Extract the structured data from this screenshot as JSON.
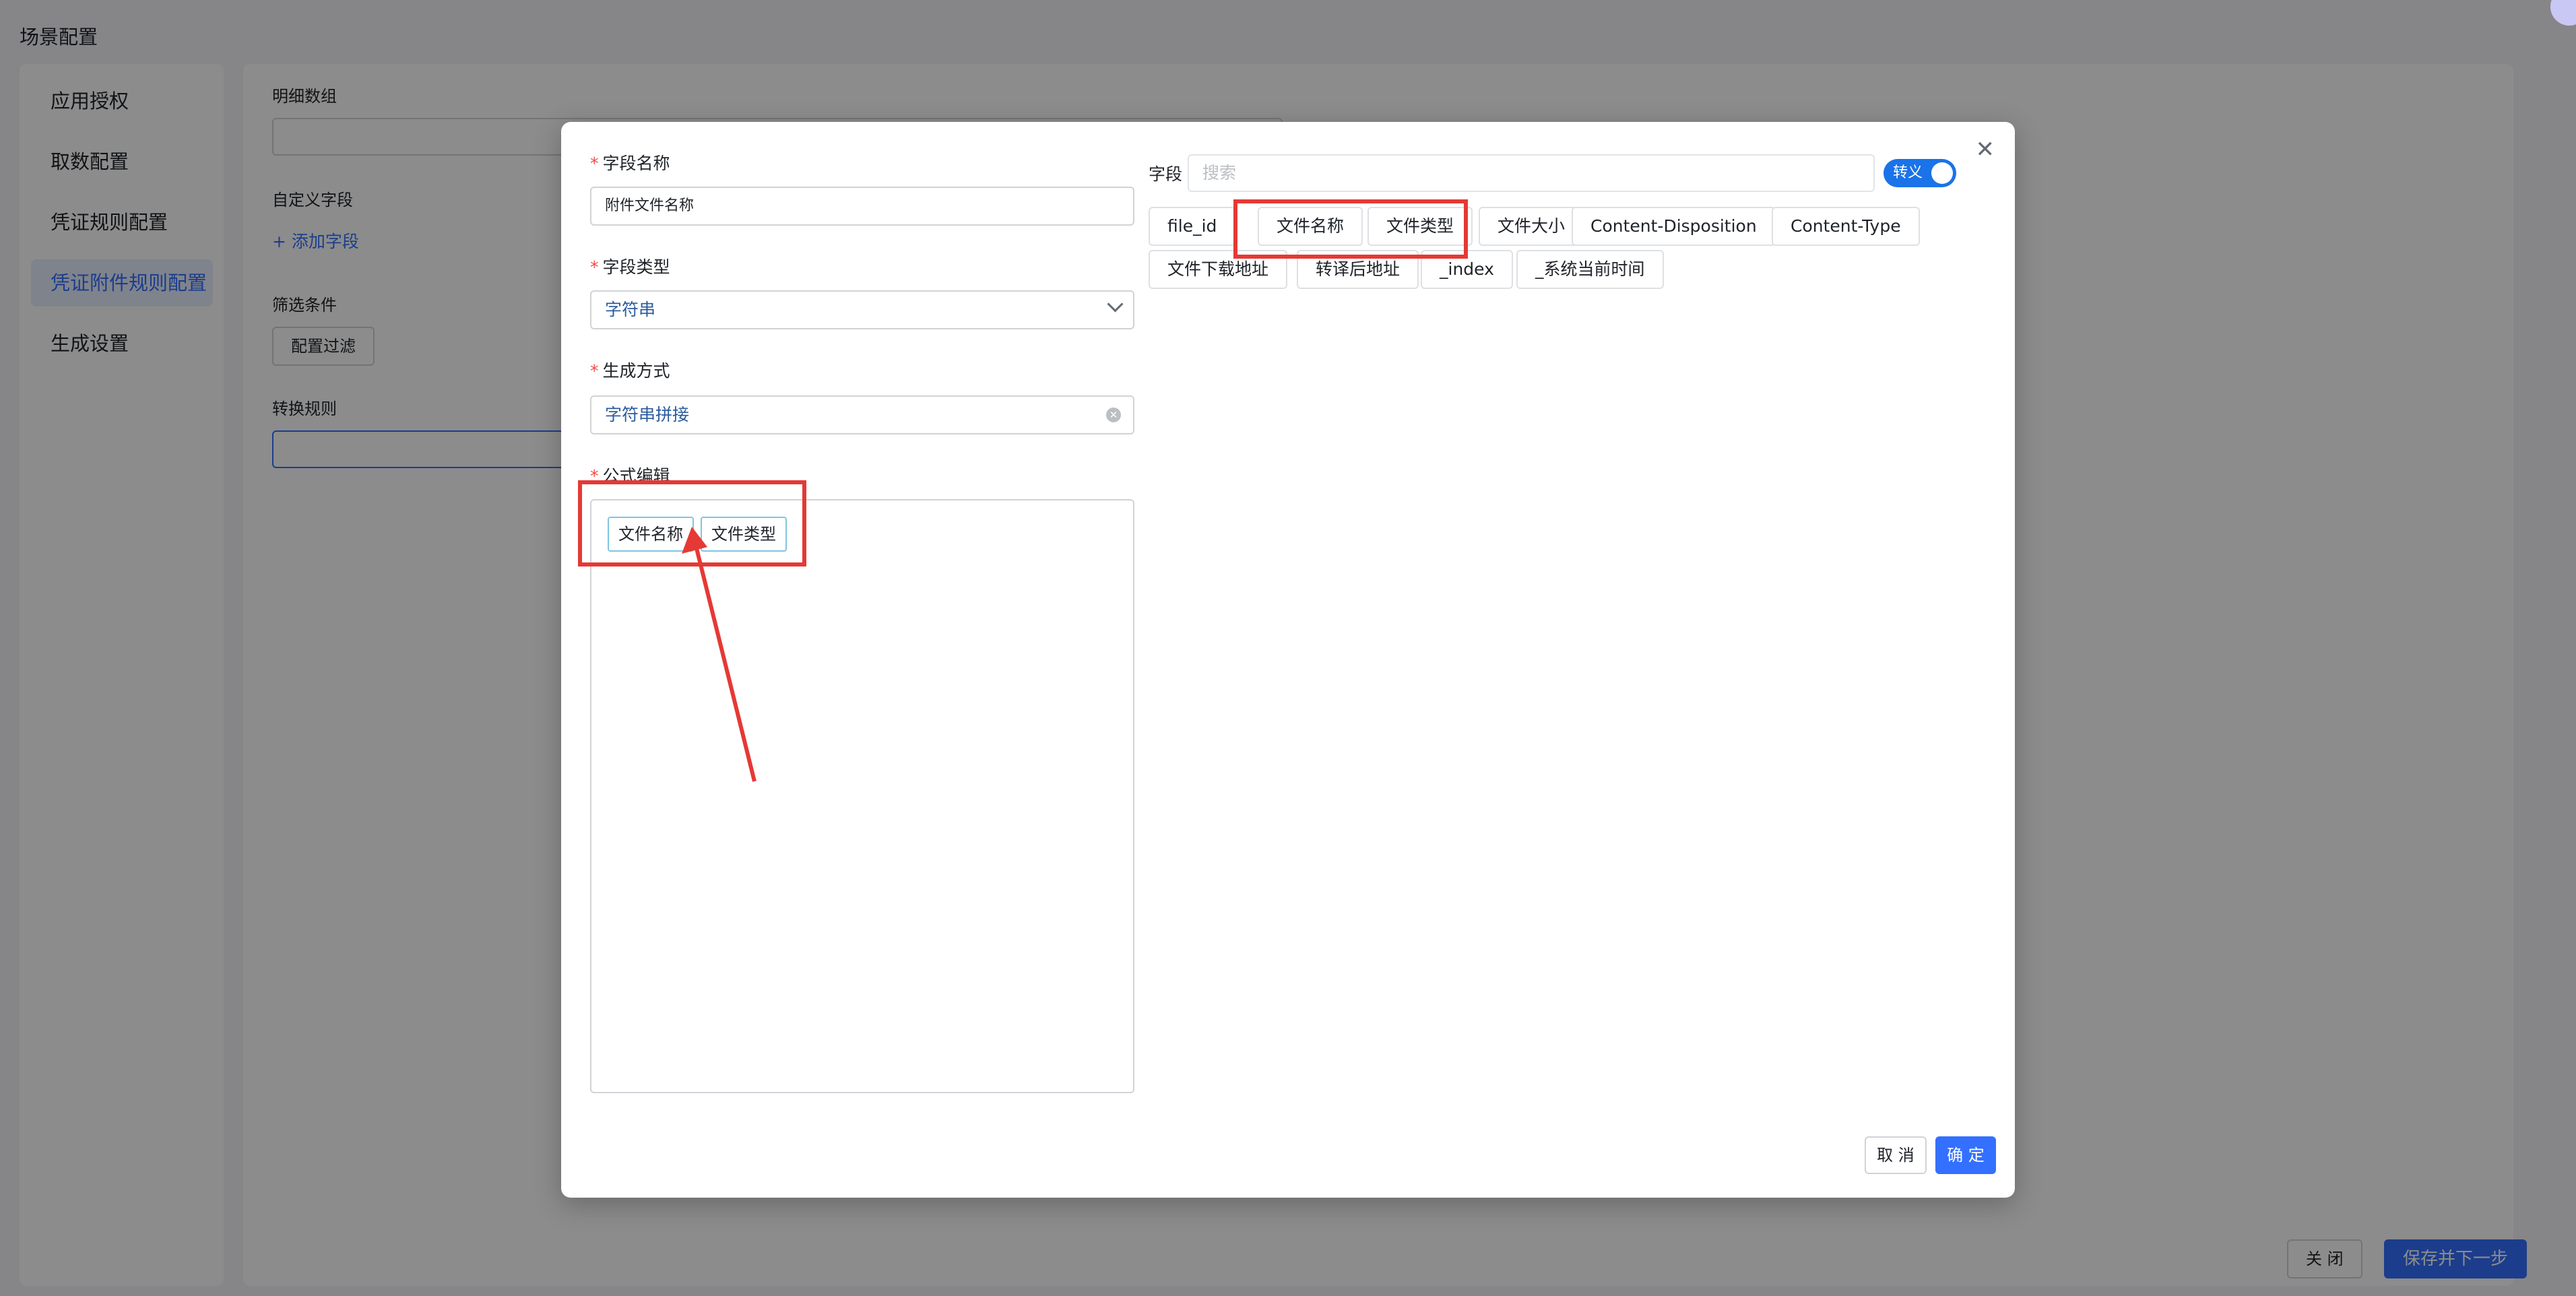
{
  "page": {
    "title": "场景配置"
  },
  "left_nav": {
    "items": [
      {
        "label": "应用授权",
        "active": false
      },
      {
        "label": "取数配置",
        "active": false
      },
      {
        "label": "凭证规则配置",
        "active": false
      },
      {
        "label": "凭证附件规则配置",
        "active": true
      },
      {
        "label": "生成设置",
        "active": false
      }
    ]
  },
  "main": {
    "detail_array_label": "明细数组",
    "custom_fields_label": "自定义字段",
    "add_field_link": "+ 添加字段",
    "filter_label": "筛选条件",
    "config_filter_button": "配置过滤",
    "transform_rule_label": "转换规则",
    "close_button": "关 闭",
    "save_next_button": "保存并下一步"
  },
  "modal": {
    "field_name": {
      "label": "字段名称",
      "value": "附件文件名称"
    },
    "field_type": {
      "label": "字段类型",
      "value": "字符串"
    },
    "gen_method": {
      "label": "生成方式",
      "value": "字符串拼接"
    },
    "formula": {
      "label": "公式编辑",
      "chips": [
        "文件名称",
        "文件类型"
      ],
      "separator": "."
    },
    "fields_label": "字段",
    "search_placeholder": "搜索",
    "toggle": {
      "label": "转义",
      "on": true
    },
    "field_tags": [
      "file_id",
      "文件名称",
      "文件类型",
      "文件大小",
      "Content-Disposition",
      "Content-Type",
      "文件下载地址",
      "转译后地址",
      "_index",
      "_系统当前时间"
    ],
    "cancel_button": "取 消",
    "ok_button": "确 定"
  },
  "colors": {
    "primary": "#3370ff",
    "annotation": "#e53935",
    "toggle_on": "#1a73e8"
  }
}
